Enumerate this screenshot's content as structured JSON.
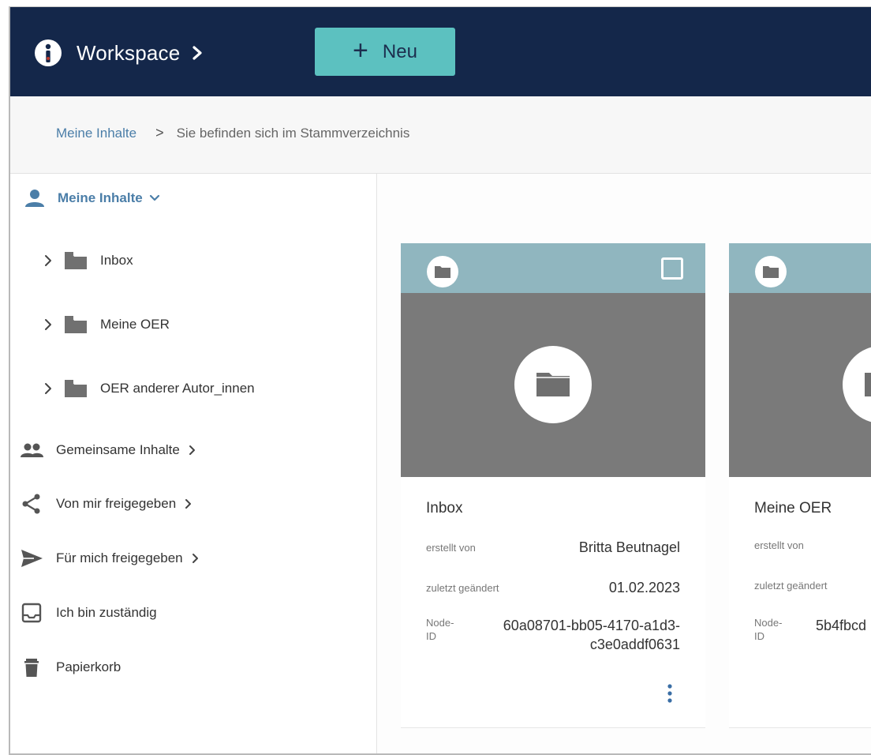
{
  "header": {
    "title": "Workspace",
    "new_button_label": "Neu",
    "new_button_plus": "+"
  },
  "breadcrumb": {
    "root": "Meine Inhalte",
    "separator": ">",
    "current": "Sie befinden sich im Stammverzeichnis"
  },
  "sidebar": {
    "root_label": "Meine Inhalte",
    "folders": [
      {
        "label": "Inbox"
      },
      {
        "label": "Meine OER"
      },
      {
        "label": "OER anderer Autor_innen"
      }
    ],
    "items": [
      {
        "label": "Gemeinsame Inhalte",
        "icon": "people-icon",
        "has_chevron": true
      },
      {
        "label": "Von mir freigegeben",
        "icon": "share-icon",
        "has_chevron": true
      },
      {
        "label": "Für mich freigegeben",
        "icon": "send-icon",
        "has_chevron": true
      },
      {
        "label": "Ich bin zuständig",
        "icon": "inbox-icon",
        "has_chevron": false
      },
      {
        "label": "Papierkorb",
        "icon": "trash-icon",
        "has_chevron": false
      }
    ]
  },
  "cards": [
    {
      "title": "Inbox",
      "created_by_label": "erstellt von",
      "created_by": "Britta Beutnagel",
      "modified_label": "zuletzt geändert",
      "modified": "01.02.2023",
      "node_label_1": "Node-",
      "node_label_2": "ID",
      "node_id_line1": "60a08701-bb05-4170-a1d3-",
      "node_id_line2": "c3e0addf0631"
    },
    {
      "title": "Meine OER",
      "created_by_label": "erstellt von",
      "modified_label": "zuletzt geändert",
      "node_label_1": "Node-",
      "node_label_2": "ID",
      "node_id_line1": "5b4fbcd"
    }
  ],
  "colors": {
    "topbar": "#14274a",
    "accent_button": "#5cc1c0",
    "link": "#4b7ea8",
    "card_header": "#90b6bf",
    "card_preview": "#7a7a7a",
    "more_dots": "#3a6ea5"
  }
}
